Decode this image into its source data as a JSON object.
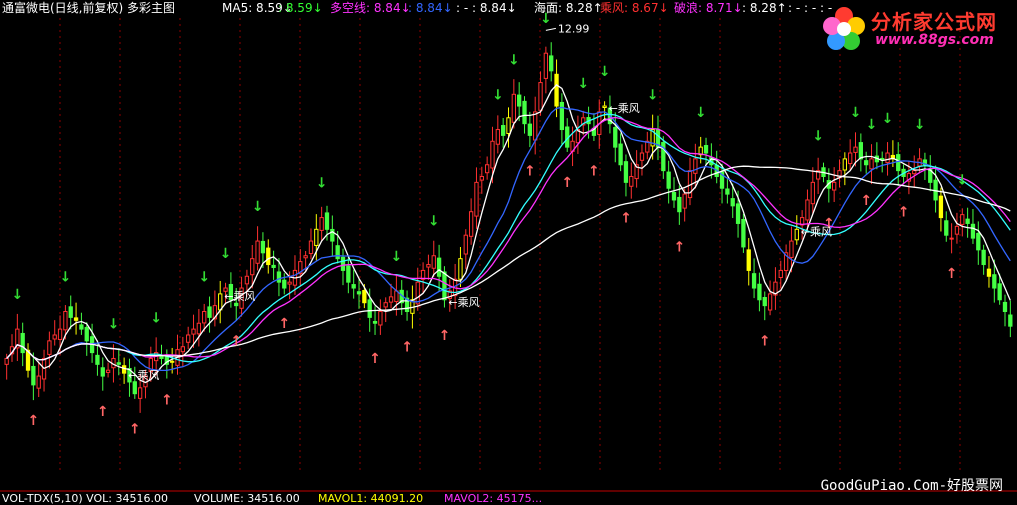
{
  "header": {
    "title": "通富微电(日线,前复权) 多彩主图",
    "ma5": "MA5: 8.59↓",
    "v2": ": 8.59↓",
    "dkx": "多空线: 8.84↓",
    "v4": ": 8.84↓",
    "v5": ": - : 8.84↓",
    "haimian": "海面: 8.28↑",
    "chengfeng": "乘风: 8.67↓",
    "polang": "破浪: 8.71↓",
    "v9": ": 8.28↑",
    "v10": ": - : - : -"
  },
  "footer": {
    "f1": "VOL-TDX(5,10) VOL: 34516.00",
    "f2": "VOLUME: 34516.00",
    "f3": "MAVOL1: 44091.20",
    "f4": "MAVOL2: 45175..."
  },
  "logo": {
    "title": "分析家公式网",
    "url": "www.88gs.com"
  },
  "watermark": "GoodGuPiao.Com-好股票网",
  "colors": {
    "bg": "#000000",
    "up": "#ff3030",
    "down": "#44ff44",
    "yellow": "#ffff00",
    "ma_white": "#ffffff",
    "ma_magenta": "#ff33ff",
    "ma_blue": "#3366ff",
    "ma_cyan": "#33ffff",
    "grid": "#8b0000",
    "arrow_down": "#33dd33",
    "arrow_up": "#ff6666"
  },
  "chart_data": {
    "type": "candlestick",
    "ylim": [
      5.5,
      13.2
    ],
    "close": [
      7.4,
      7.6,
      7.9,
      7.5,
      7.2,
      6.95,
      7.1,
      7.4,
      7.7,
      7.8,
      7.9,
      8.2,
      8.1,
      8.05,
      7.9,
      7.7,
      7.5,
      7.3,
      7.1,
      7.2,
      7.4,
      7.3,
      7.15,
      7.0,
      6.8,
      6.9,
      7.1,
      7.4,
      7.5,
      7.4,
      7.3,
      7.35,
      7.55,
      7.6,
      7.8,
      7.9,
      8.0,
      8.2,
      8.1,
      8.3,
      8.5,
      8.6,
      8.4,
      8.3,
      8.6,
      8.8,
      9.1,
      9.4,
      9.2,
      9.0,
      8.95,
      8.7,
      8.6,
      8.7,
      8.9,
      9.05,
      9.15,
      9.4,
      9.6,
      9.8,
      9.6,
      9.4,
      9.1,
      8.9,
      8.7,
      8.6,
      8.5,
      8.35,
      8.1,
      8.0,
      8.2,
      8.35,
      8.45,
      8.55,
      8.35,
      8.2,
      8.4,
      8.7,
      8.9,
      9.0,
      9.15,
      8.8,
      8.4,
      8.55,
      8.75,
      9.1,
      9.5,
      9.9,
      10.4,
      10.5,
      10.7,
      11.1,
      11.3,
      11.2,
      11.5,
      11.9,
      11.7,
      11.4,
      11.2,
      11.6,
      12.1,
      12.6,
      12.3,
      11.7,
      11.3,
      11.0,
      11.1,
      11.3,
      11.5,
      11.4,
      11.2,
      11.6,
      11.7,
      11.4,
      11.0,
      10.7,
      10.4,
      10.5,
      10.7,
      10.9,
      11.1,
      11.3,
      11.0,
      10.6,
      10.3,
      10.1,
      9.9,
      10.2,
      10.6,
      10.8,
      11.0,
      10.9,
      10.7,
      10.5,
      10.3,
      10.2,
      10.0,
      9.7,
      9.3,
      8.9,
      8.6,
      8.4,
      8.3,
      8.5,
      8.7,
      8.9,
      9.2,
      9.4,
      9.6,
      9.8,
      10.1,
      10.4,
      10.6,
      10.5,
      10.3,
      10.4,
      10.6,
      10.8,
      10.9,
      11.0,
      10.8,
      10.7,
      10.8,
      10.75,
      10.8,
      10.9,
      10.8,
      10.6,
      10.5,
      10.55,
      10.6,
      10.8,
      10.7,
      10.4,
      10.1,
      9.8,
      9.5,
      9.45,
      9.65,
      9.85,
      9.7,
      9.45,
      9.25,
      9.0,
      8.8,
      8.6,
      8.4,
      8.2,
      7.95
    ],
    "series": [
      {
        "name": "MA5",
        "period": 5,
        "color": "#ffffff"
      },
      {
        "name": "乘风",
        "period": 13,
        "color": "#3366ff"
      },
      {
        "name": "破浪",
        "period": 21,
        "color": "#33ffff"
      },
      {
        "name": "多空线",
        "period": 24,
        "color": "#ff33ff"
      },
      {
        "name": "海面",
        "period": 60,
        "color": "#ffffff"
      }
    ],
    "annotations": [
      {
        "text": "12.99",
        "type": "high",
        "value": 12.99
      },
      {
        "text": "←乘风",
        "type": "label"
      }
    ]
  }
}
